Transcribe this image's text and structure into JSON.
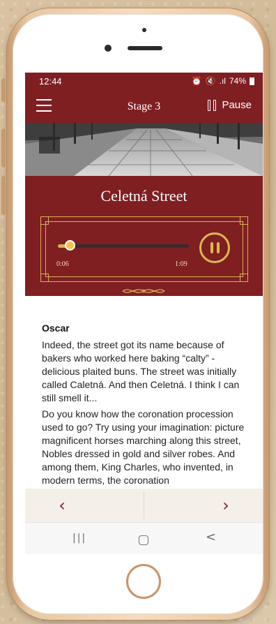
{
  "status_bar": {
    "time": "12:44",
    "signal_text": ".ıl",
    "battery": "74%"
  },
  "app_bar": {
    "title": "Stage 3",
    "pause_label": "Pause"
  },
  "player": {
    "location_title": "Celetná Street",
    "current_time": "0:06",
    "total_time": "1:09",
    "progress_fraction": 0.09
  },
  "content": {
    "speaker": "Oscar",
    "paragraphs": [
      "Indeed, the street got its name because of bakers who worked here baking “calty” - delicious plaited buns. The street was initially called Caletná. And then Celetná. I think I can still smell it...",
      "Do you know how the coronation procession used to go? Try using your imagination: picture magnificent horses marching along this street, Nobles dressed in gold and silver robes. And among them, King Charles, who invented, in modern terms, the coronation"
    ]
  },
  "navigation": {
    "prev_glyph": "‹",
    "next_glyph": "›"
  },
  "system_nav": {
    "recent_glyph": "|||",
    "back_glyph": "<"
  },
  "colors": {
    "brand": "#7f1f22",
    "accent_gold": "#d8b15b"
  }
}
